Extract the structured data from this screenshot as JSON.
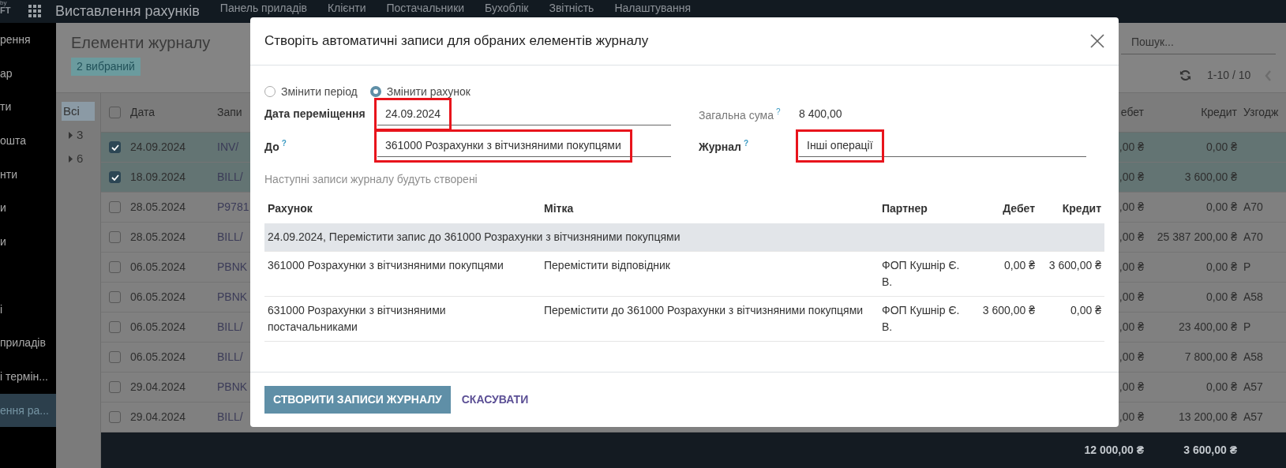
{
  "navbar": {
    "logo_lines": [
      "by",
      "FT"
    ],
    "app_name": "Виставлення рахунків",
    "menu": [
      "Панель приладів",
      "Клієнти",
      "Постачальники",
      "Бухоблік",
      "Звітність",
      "Налаштування"
    ]
  },
  "sidebar": {
    "items": [
      {
        "label": "рення",
        "selected": false
      },
      {
        "label": "ар",
        "selected": false
      },
      {
        "label": "ти",
        "selected": false
      },
      {
        "label": "ошта",
        "selected": false
      },
      {
        "label": "нти",
        "selected": false
      },
      {
        "label": "и",
        "selected": false
      },
      {
        "label": "и",
        "selected": false
      },
      {
        "selected": false
      },
      {
        "label": "і",
        "selected": false
      },
      {
        "label": "приладів",
        "selected": false
      },
      {
        "label": "і термін...",
        "selected": false
      },
      {
        "label": "ення ра...",
        "selected": true
      }
    ]
  },
  "control_panel": {
    "title": "Елементи журналу",
    "selection": "2 вибраний",
    "search_placeholder": "Пошук...",
    "pager": "1-10 / 10"
  },
  "filter_panel": {
    "items": [
      {
        "label": "Всі",
        "selected": true,
        "expandable": false
      },
      {
        "label": "3",
        "selected": false,
        "expandable": true
      },
      {
        "label": "6",
        "selected": false,
        "expandable": true
      }
    ]
  },
  "table": {
    "all_selected": false,
    "columns": [
      "Дата",
      "Запи",
      "ебет",
      "Кредит",
      "Узгодж"
    ],
    "rows": [
      {
        "selected": true,
        "date": "24.09.2024",
        "entry": "INV/",
        "debit": ",00 ₴",
        "credit": "0,00 ₴"
      },
      {
        "selected": true,
        "date": "18.09.2024",
        "entry": "BILL/",
        "debit": ",00 ₴",
        "credit": "3 600,00 ₴"
      },
      {
        "selected": false,
        "date": "28.05.2024",
        "entry": "P9781",
        "debit": ",00 ₴",
        "credit": "0,00 ₴",
        "matching": "A70"
      },
      {
        "selected": false,
        "date": "28.05.2024",
        "entry": "BILL/",
        "debit": ",00 ₴",
        "credit": "25 387 200,00 ₴",
        "matching": "A70"
      },
      {
        "selected": false,
        "date": "06.05.2024",
        "entry": "PBNK",
        "debit": ",00 ₴",
        "credit": "0,00 ₴",
        "matching": "P"
      },
      {
        "selected": false,
        "date": "06.05.2024",
        "entry": "PBNK",
        "debit": ",00 ₴",
        "credit": "0,00 ₴",
        "matching": "A58"
      },
      {
        "selected": false,
        "date": "06.05.2024",
        "entry": "BILL/",
        "debit": ",00 ₴",
        "credit": "23 400,00 ₴",
        "matching": "P"
      },
      {
        "selected": false,
        "date": "06.05.2024",
        "entry": "BILL/",
        "debit": ",00 ₴",
        "credit": "7 800,00 ₴",
        "matching": "A58"
      },
      {
        "selected": false,
        "date": "29.04.2024",
        "entry": "PBNK",
        "debit": ",00 ₴",
        "credit": "0,00 ₴",
        "matching": "A57"
      },
      {
        "selected": false,
        "date": "29.04.2024",
        "entry": "BILL/",
        "debit": ",00 ₴",
        "credit": "13 200,00 ₴",
        "matching": "A57"
      }
    ],
    "totals": {
      "debit": "12 000,00 ₴",
      "credit": "3 600,00 ₴"
    }
  },
  "dialog": {
    "title": "Створіть автоматичні записи для обраних елементів журналу",
    "options": [
      {
        "label": "Змінити період",
        "selected": false
      },
      {
        "label": "Змінити рахунок",
        "selected": true
      }
    ],
    "left_fields": [
      {
        "kind": "input",
        "label": "Дата переміщення",
        "value": "24.09.2024",
        "highlighted": true
      },
      {
        "kind": "input",
        "label": "До",
        "help": "?",
        "value": "361000 Розрахунки з вітчизняними покупцями",
        "highlighted": true
      }
    ],
    "right_fields": [
      {
        "kind": "readonly",
        "label": "Загальна сума",
        "help": "?",
        "value": "8 400,00"
      },
      {
        "kind": "input",
        "label": "Журнал",
        "help": "?",
        "value": "Інші операції",
        "highlighted": true
      }
    ],
    "note": "Наступні записи журналу будуть створені",
    "preview": {
      "columns": [
        "Рахунок",
        "Мітка",
        "Партнер",
        "Дебет",
        "Кредит"
      ],
      "groups": [
        {
          "title": "24.09.2024, Перемістити запис до 361000 Розрахунки з вітчизняними покупцями",
          "rows": [
            {
              "account": "361000 Розрахунки з вітчизняними покупцями",
              "label": "Перемістити відповідник",
              "partner": "ФОП Кушнір Є. В.",
              "debit": "0,00 ₴",
              "credit": "3 600,00 ₴"
            },
            {
              "account": "631000 Розрахунки з вітчизняними постачальниками",
              "label": "Перемістити до 361000 Розрахунки з вітчизняними покупцями",
              "partner": "ФОП Кушнір Є. В.",
              "debit": "3 600,00 ₴",
              "credit": "0,00 ₴"
            }
          ]
        }
      ]
    },
    "buttons": [
      {
        "kind": "primary",
        "label": "СТВОРИТИ ЗАПИСИ ЖУРНАЛУ"
      },
      {
        "kind": "link",
        "label": "СКАСУВАТИ"
      }
    ]
  }
}
